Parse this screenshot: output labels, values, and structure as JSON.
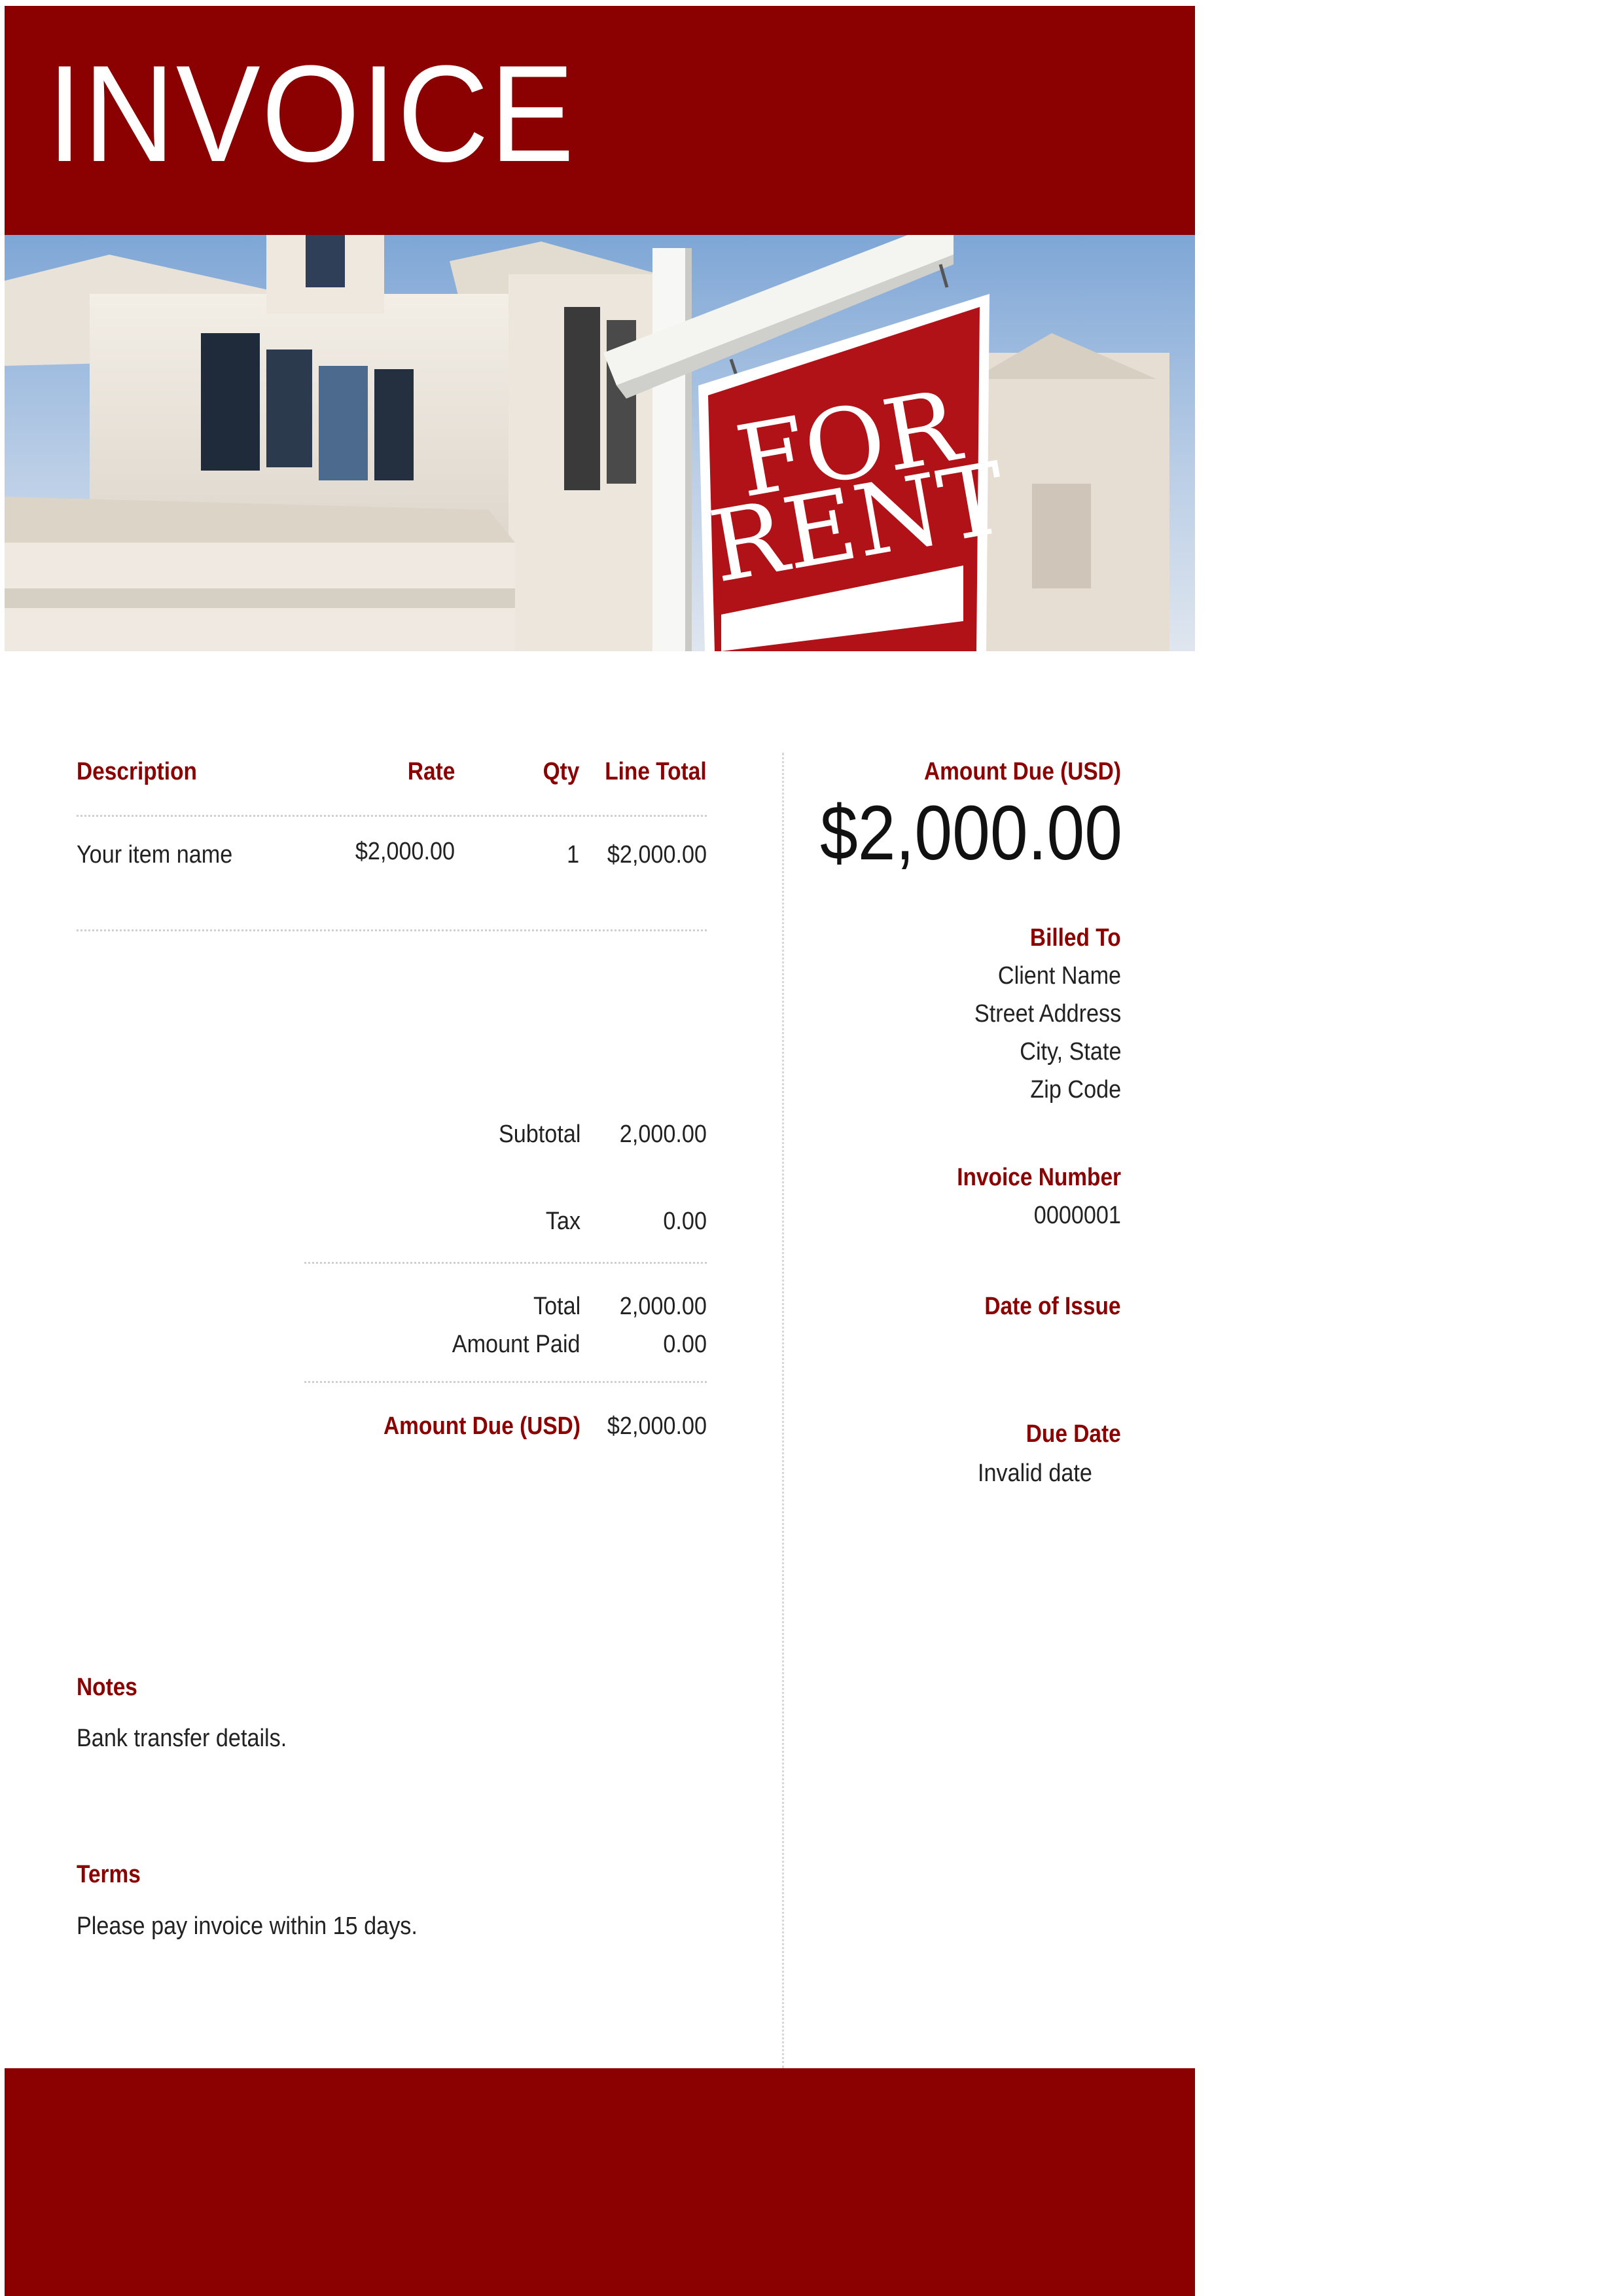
{
  "header": {
    "title": "INVOICE",
    "brand_color": "#8b0000"
  },
  "hero_sign": {
    "line1": "FOR",
    "line2": "RENT"
  },
  "table": {
    "columns": {
      "description": "Description",
      "rate": "Rate",
      "qty": "Qty",
      "line_total": "Line Total"
    },
    "rows": [
      {
        "description": "Your item name",
        "rate": "$2,000.00",
        "qty": "1",
        "line_total": "$2,000.00"
      }
    ]
  },
  "totals": {
    "subtotal_label": "Subtotal",
    "subtotal_value": "2,000.00",
    "tax_label": "Tax",
    "tax_value": "0.00",
    "total_label": "Total",
    "total_value": "2,000.00",
    "amount_paid_label": "Amount Paid",
    "amount_paid_value": "0.00",
    "amount_due_label": "Amount Due (USD)",
    "amount_due_value": "$2,000.00"
  },
  "summary": {
    "amount_due_label": "Amount Due (USD)",
    "amount_due_value": "$2,000.00",
    "billed_to_label": "Billed To",
    "billed_to_lines": [
      "Client Name",
      "Street Address",
      "City, State",
      "Zip Code"
    ],
    "invoice_number_label": "Invoice Number",
    "invoice_number_value": "0000001",
    "date_of_issue_label": "Date of Issue",
    "due_date_label": "Due Date",
    "due_date_value": "Invalid date"
  },
  "notes": {
    "label": "Notes",
    "text": "Bank transfer details."
  },
  "terms": {
    "label": "Terms",
    "text": "Please pay invoice within 15 days."
  }
}
